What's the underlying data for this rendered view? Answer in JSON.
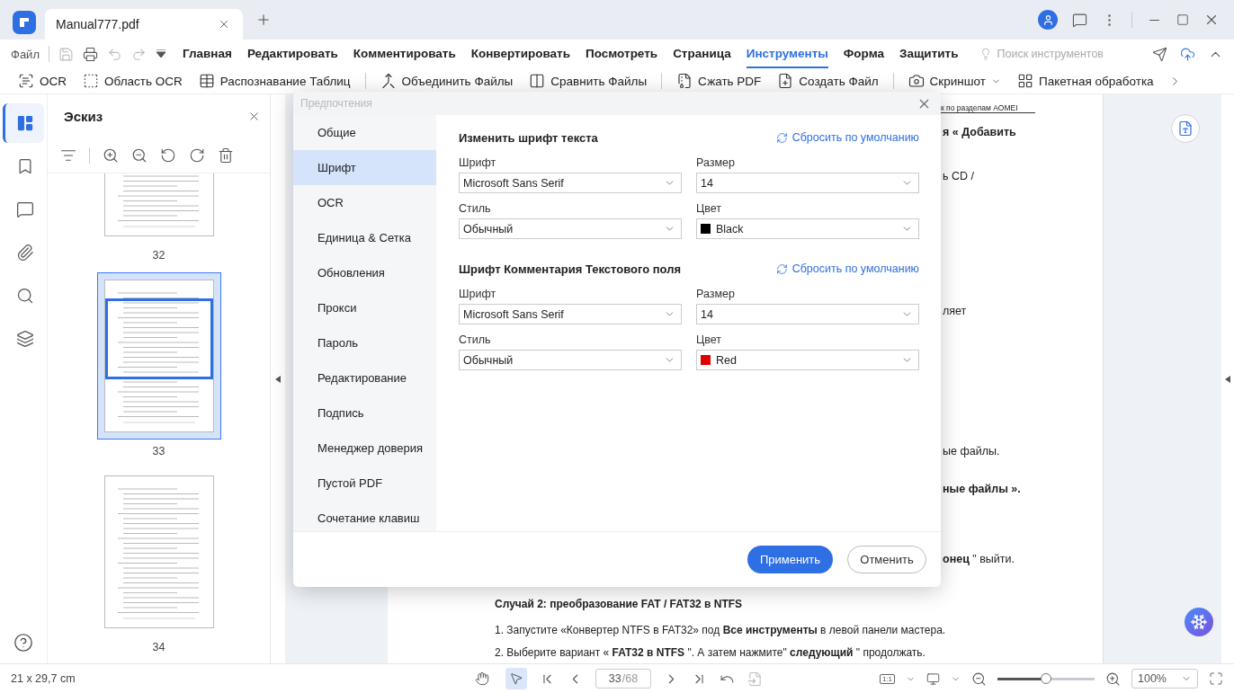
{
  "app": {
    "tab_title": "Manual777.pdf"
  },
  "menu": {
    "file": "Файл",
    "tabs": [
      {
        "label": "Главная",
        "selected": false
      },
      {
        "label": "Редактировать",
        "selected": false
      },
      {
        "label": "Комментировать",
        "selected": false
      },
      {
        "label": "Конвертировать",
        "selected": false
      },
      {
        "label": "Посмотреть",
        "selected": false
      },
      {
        "label": "Страница",
        "selected": false
      },
      {
        "label": "Инструменты",
        "selected": true
      },
      {
        "label": "Форма",
        "selected": false
      },
      {
        "label": "Защитить",
        "selected": false
      }
    ],
    "search_placeholder": "Поиск инструментов"
  },
  "toolbar": {
    "groups": [
      {
        "tools": [
          {
            "label": "OCR"
          },
          {
            "label": "Область OCR"
          },
          {
            "label": "Распознавание Таблиц"
          }
        ]
      },
      {
        "tools": [
          {
            "label": "Объединить Файлы"
          },
          {
            "label": "Сравнить Файлы"
          }
        ]
      },
      {
        "tools": [
          {
            "label": "Сжать PDF"
          },
          {
            "label": "Создать Файл"
          }
        ]
      },
      {
        "tools": [
          {
            "label": "Скриншот"
          },
          {
            "label": "Пакетная обработка"
          }
        ]
      }
    ]
  },
  "rail": [
    {
      "selected": true
    },
    {
      "selected": false
    },
    {
      "selected": false
    },
    {
      "selected": false
    },
    {
      "selected": false
    },
    {
      "selected": false
    }
  ],
  "thumbnails": {
    "title": "Эскиз",
    "pages": [
      {
        "label": "32",
        "selected": false
      },
      {
        "label": "33",
        "selected": true
      },
      {
        "label": "34",
        "selected": false
      }
    ]
  },
  "document": {
    "header": "к по разделам AOMEI",
    "lines": [
      {
        "kind": "fragment",
        "text": "**я « Добавить**"
      },
      {
        "kind": "fragment",
        "text": "ь CD /"
      },
      {
        "kind": "fragment",
        "text": "ляет"
      },
      {
        "kind": "fragment",
        "text": "ые файлы."
      },
      {
        "kind": "fragment",
        "text": "**ные файлы ».**"
      },
      {
        "kind": "fragment",
        "text": "**онец** \" выйти."
      },
      {
        "kind": "heading",
        "text": "Случай 2: преобразование FAT / FAT32 в NTFS"
      },
      {
        "kind": "line",
        "text": "1. Запустите «Конвертер NTFS в FAT32» под **Все инструменты** в левой панели мастера."
      },
      {
        "kind": "line",
        "text": "2. Выберите вариант « **FAT32 в NTFS** \". А затем нажмите\" **следующий** \" продолжать."
      }
    ]
  },
  "dialog": {
    "title": "Предпочтения",
    "nav": [
      {
        "label": "Общие",
        "selected": false
      },
      {
        "label": "Шрифт",
        "selected": true
      },
      {
        "label": "OCR",
        "selected": false
      },
      {
        "label": "Единица & Сетка",
        "selected": false
      },
      {
        "label": "Обновления",
        "selected": false
      },
      {
        "label": "Прокси",
        "selected": false
      },
      {
        "label": "Пароль",
        "selected": false
      },
      {
        "label": "Редактирование",
        "selected": false
      },
      {
        "label": "Подпись",
        "selected": false
      },
      {
        "label": "Менеджер доверия",
        "selected": false
      },
      {
        "label": "Пустой PDF",
        "selected": false
      },
      {
        "label": "Сочетание клавиш",
        "selected": false
      }
    ],
    "sections": [
      {
        "title": "Изменить шрифт текста",
        "reset": "Сбросить по умолчанию",
        "fields": [
          {
            "kind": "select",
            "label": "Шрифт",
            "value": "Microsoft Sans Serif"
          },
          {
            "kind": "select",
            "label": "Размер",
            "value": "14"
          },
          {
            "kind": "select",
            "label": "Стиль",
            "value": "Обычный"
          },
          {
            "kind": "color",
            "label": "Цвет",
            "value": "Black",
            "color": "#000000"
          }
        ]
      },
      {
        "title": "Шрифт Комментария Текстового поля",
        "reset": "Сбросить по умолчанию",
        "fields": [
          {
            "kind": "select",
            "label": "Шрифт",
            "value": "Microsoft Sans Serif"
          },
          {
            "kind": "select",
            "label": "Размер",
            "value": "14"
          },
          {
            "kind": "select",
            "label": "Стиль",
            "value": "Обычный"
          },
          {
            "kind": "color",
            "label": "Цвет",
            "value": "Red",
            "color": "#e00000"
          }
        ]
      }
    ],
    "apply": "Применить",
    "cancel": "Отменить"
  },
  "status_bar": {
    "page_size": "21 x 29,7 cm",
    "tools": [
      {
        "selected": false
      },
      {
        "selected": true
      }
    ],
    "page_value": "33",
    "page_total": "/68",
    "fit": "1:1",
    "level": 0.5,
    "zoom": "100%"
  }
}
